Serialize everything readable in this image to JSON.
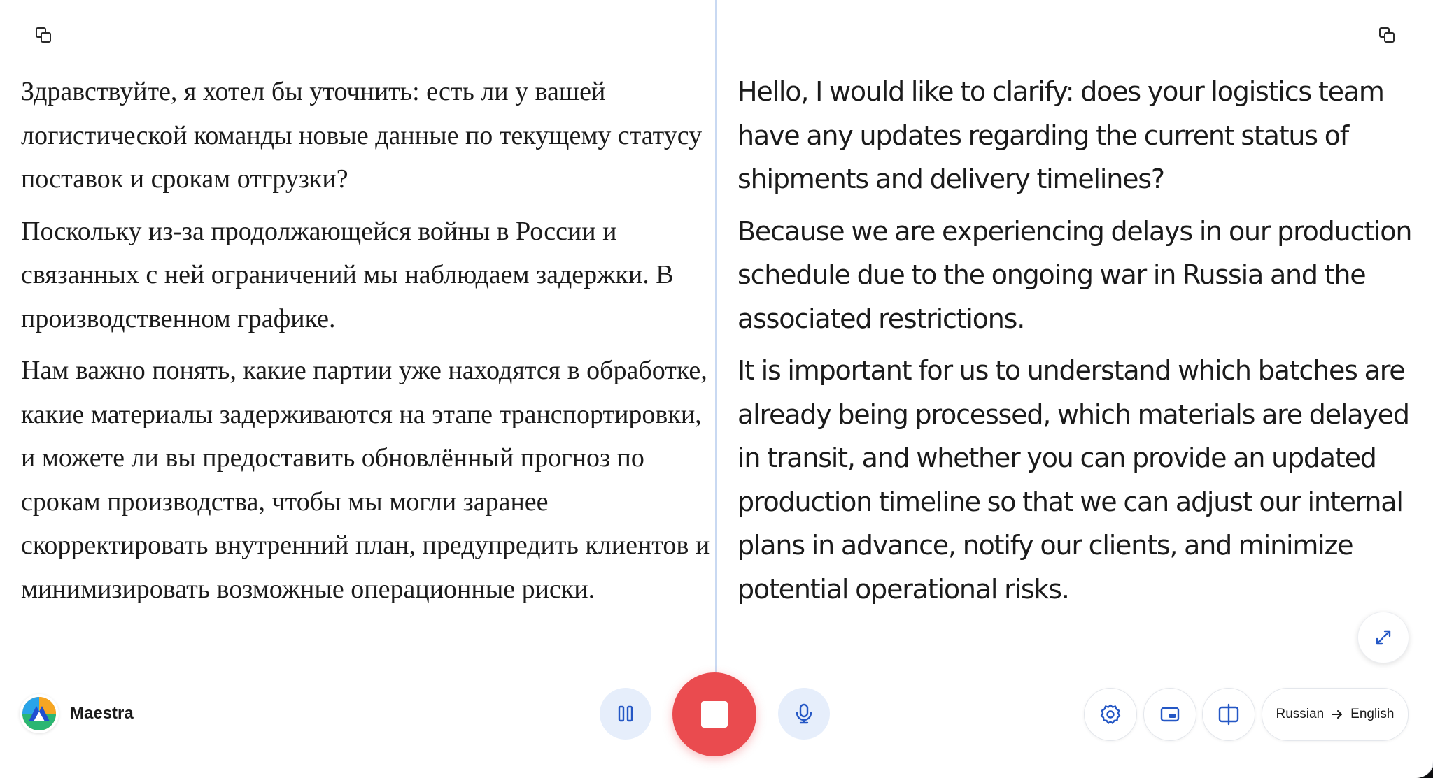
{
  "source_text": {
    "paragraphs": [
      "Здравствуйте, я хотел бы уточнить: есть ли у вашей логистической команды новые данные по текущему статусу поставок и срокам отгрузки?",
      "Поскольку из-за продолжающейся войны в России и связанных с ней ограничений мы наблюдаем задержки. В производственном графике.",
      "Нам важно понять, какие партии уже находятся в обработке, какие материалы задерживаются на этапе транспортировки, и можете ли вы предоставить обновлённый прогноз по срокам производства, чтобы мы могли заранее скорректировать внутренний план, предупредить клиентов и минимизировать возможные операционные риски."
    ]
  },
  "translated_text": {
    "paragraphs": [
      "Hello, I would like to clarify: does your logistics team have any updates regarding the current status of shipments and delivery timelines?",
      "Because we are experiencing delays in our production schedule due to the ongoing war in Russia and the associated restrictions.",
      "It is important for us to understand which batches are already being processed, which materials are delayed in transit, and whether you can provide an updated production timeline so that we can adjust our internal plans in advance, notify our clients, and minimize potential operational risks."
    ]
  },
  "brand": {
    "name": "Maestra"
  },
  "language": {
    "source": "Russian",
    "target": "English"
  },
  "colors": {
    "stop_button": "#ea4b4f",
    "control_bg": "#e6eefb",
    "icon_blue": "#2457c5",
    "divider": "#c9d9f2"
  },
  "icons": {
    "copy_left": "copy-icon",
    "copy_right": "copy-icon",
    "expand": "expand-icon",
    "pause": "pause-icon",
    "stop": "stop-icon",
    "mic": "microphone-icon",
    "settings": "gear-icon",
    "pip": "picture-in-picture-icon",
    "split": "split-view-icon",
    "arrow": "arrow-right-icon"
  }
}
